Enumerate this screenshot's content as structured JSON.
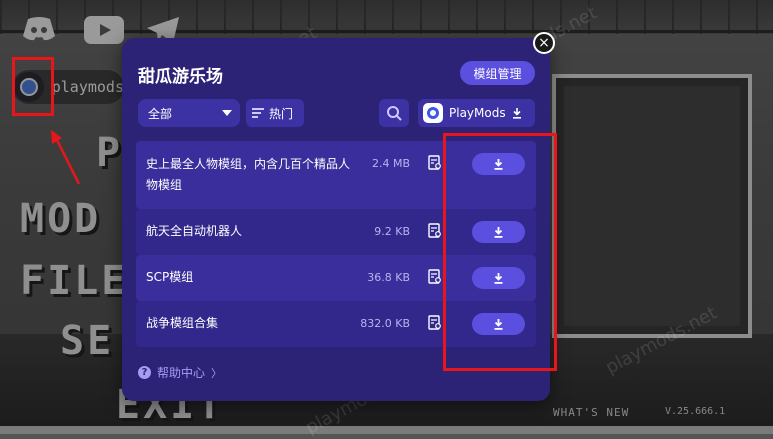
{
  "background": {
    "profile_name": "playmods",
    "menu_words": [
      "P",
      "MOD",
      "FILE",
      "SE",
      "EXIT"
    ],
    "whats_new": "WHAT'S NEW",
    "version": "V.25.666.1",
    "watermark": "playmods.net"
  },
  "dialog": {
    "title": "甜瓜游乐场",
    "manage_label": "模组管理",
    "close_icon": "×",
    "category": "全部",
    "sort_label": "热门",
    "source_label": "PlayMods",
    "help_label": "帮助中心",
    "help_chevron": "〉",
    "help_icon": "?",
    "items": [
      {
        "name": "史上最全人物模组，内含几百个精品人物模组",
        "size": "2.4 MB"
      },
      {
        "name": "航天全自动机器人",
        "size": "9.2 KB"
      },
      {
        "name": "SCP模组",
        "size": "36.8 KB"
      },
      {
        "name": "战争模组合集",
        "size": "832.0 KB"
      }
    ]
  },
  "colors": {
    "dialog_bg": "#2c2377",
    "accent": "#5b4fe0",
    "highlight": "#e8161b"
  }
}
